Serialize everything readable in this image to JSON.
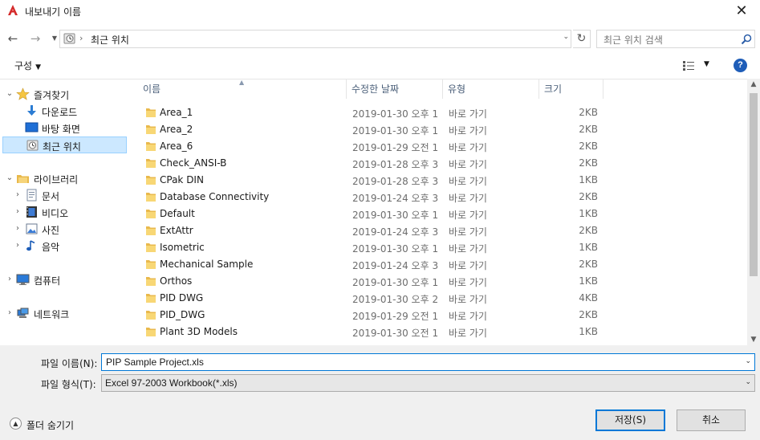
{
  "window": {
    "title": "내보내기 이름"
  },
  "address": {
    "path": "최근 위치",
    "separator": "›"
  },
  "search": {
    "placeholder": "최근 위치 검색"
  },
  "toolbar": {
    "organize_label": "구성"
  },
  "nav": {
    "items": [
      {
        "label": "즐겨찾기",
        "icon": "star-icon",
        "expand": "expanded",
        "indent": 0
      },
      {
        "label": "다운로드",
        "icon": "download-icon",
        "expand": "none",
        "indent": 1
      },
      {
        "label": "바탕 화면",
        "icon": "desktop-icon",
        "expand": "none",
        "indent": 1
      },
      {
        "label": "최근 위치",
        "icon": "recent-places-icon",
        "expand": "none",
        "indent": 1,
        "selected": true
      },
      {
        "label": "라이브러리",
        "icon": "library-icon",
        "expand": "expanded",
        "indent": 0
      },
      {
        "label": "문서",
        "icon": "documents-icon",
        "expand": "collapsed",
        "indent": 1
      },
      {
        "label": "비디오",
        "icon": "videos-icon",
        "expand": "collapsed",
        "indent": 1
      },
      {
        "label": "사진",
        "icon": "pictures-icon",
        "expand": "collapsed",
        "indent": 1
      },
      {
        "label": "음악",
        "icon": "music-icon",
        "expand": "collapsed",
        "indent": 1
      },
      {
        "label": "컴퓨터",
        "icon": "computer-icon",
        "expand": "collapsed",
        "indent": 0
      },
      {
        "label": "네트워크",
        "icon": "network-icon",
        "expand": "collapsed",
        "indent": 0
      }
    ]
  },
  "columns": {
    "name": "이름",
    "date": "수정한 날짜",
    "type": "유형",
    "size": "크기"
  },
  "files": [
    {
      "name": "Area_1",
      "date": "2019-01-30 오후 1:...",
      "type": "바로 가기",
      "size": "2KB"
    },
    {
      "name": "Area_2",
      "date": "2019-01-30 오후 1:...",
      "type": "바로 가기",
      "size": "2KB"
    },
    {
      "name": "Area_6",
      "date": "2019-01-29 오전 1...",
      "type": "바로 가기",
      "size": "2KB"
    },
    {
      "name": "Check_ANSI-B",
      "date": "2019-01-28 오후 3:...",
      "type": "바로 가기",
      "size": "2KB"
    },
    {
      "name": "CPak DIN",
      "date": "2019-01-28 오후 3:...",
      "type": "바로 가기",
      "size": "1KB"
    },
    {
      "name": "Database Connectivity",
      "date": "2019-01-24 오후 3:...",
      "type": "바로 가기",
      "size": "2KB"
    },
    {
      "name": "Default",
      "date": "2019-01-30 오후 1:...",
      "type": "바로 가기",
      "size": "1KB"
    },
    {
      "name": "ExtAttr",
      "date": "2019-01-24 오후 3:...",
      "type": "바로 가기",
      "size": "2KB"
    },
    {
      "name": "Isometric",
      "date": "2019-01-30 오후 1:...",
      "type": "바로 가기",
      "size": "1KB"
    },
    {
      "name": "Mechanical Sample",
      "date": "2019-01-24 오후 3:...",
      "type": "바로 가기",
      "size": "2KB"
    },
    {
      "name": "Orthos",
      "date": "2019-01-30 오후 1:...",
      "type": "바로 가기",
      "size": "1KB"
    },
    {
      "name": "PID DWG",
      "date": "2019-01-30 오후 2:...",
      "type": "바로 가기",
      "size": "4KB"
    },
    {
      "name": "PID_DWG",
      "date": "2019-01-29 오전 1...",
      "type": "바로 가기",
      "size": "2KB"
    },
    {
      "name": "Plant 3D Models",
      "date": "2019-01-30 오전 1...",
      "type": "바로 가기",
      "size": "1KB"
    }
  ],
  "form": {
    "filename_label": "파일 이름(N):",
    "filename_value": "PIP Sample Project.xls",
    "filetype_label": "파일 형식(T):",
    "filetype_value": "Excel 97-2003 Workbook(*.xls)"
  },
  "footer": {
    "hide_folders_label": "폴더 숨기기",
    "save_label": "저장(S)",
    "cancel_label": "취소"
  },
  "colors": {
    "accent": "#0078d7",
    "folder": "#f8d775",
    "selection": "#cce8ff",
    "app_logo": "#d42b2b"
  }
}
